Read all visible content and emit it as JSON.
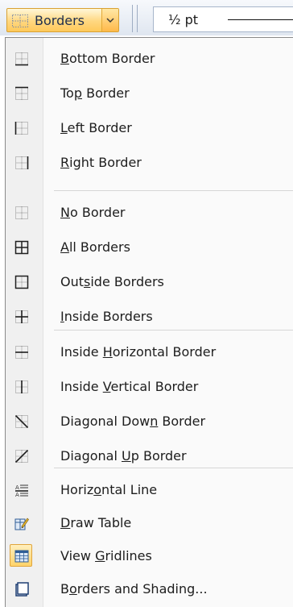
{
  "toolbar": {
    "borders_label": "Borders",
    "line_weight": "½ pt"
  },
  "colors": {
    "accent_border": "#d8a132",
    "accent_fill": "#ffd780",
    "icon_blue": "#2f5d96"
  },
  "menu": {
    "items": [
      {
        "name": "bottom-border-item",
        "icon": "bottom-border-icon",
        "label": "Bottom Border",
        "mnemonic": 0
      },
      {
        "name": "top-border-item",
        "icon": "top-border-icon",
        "label": "Top Border",
        "mnemonic": 2
      },
      {
        "name": "left-border-item",
        "icon": "left-border-icon",
        "label": "Left Border",
        "mnemonic": 0
      },
      {
        "name": "right-border-item",
        "icon": "right-border-icon",
        "label": "Right Border",
        "mnemonic": 0
      },
      {
        "name": "no-border-item",
        "icon": "no-border-icon",
        "label": "No Border",
        "mnemonic": 0
      },
      {
        "name": "all-borders-item",
        "icon": "all-borders-icon",
        "label": "All Borders",
        "mnemonic": 0
      },
      {
        "name": "outside-borders-item",
        "icon": "outside-borders-icon",
        "label": "Outside Borders",
        "mnemonic": 3
      },
      {
        "name": "inside-borders-item",
        "icon": "inside-borders-icon",
        "label": "Inside Borders",
        "mnemonic": 0
      },
      {
        "name": "inside-horizontal-border-item",
        "icon": "inside-horizontal-border-icon",
        "label": "Inside Horizontal Border",
        "mnemonic": 7
      },
      {
        "name": "inside-vertical-border-item",
        "icon": "inside-vertical-border-icon",
        "label": "Inside Vertical Border",
        "mnemonic": 7
      },
      {
        "name": "diagonal-down-border-item",
        "icon": "diagonal-down-border-icon",
        "label": "Diagonal Down Border",
        "mnemonic": 12
      },
      {
        "name": "diagonal-up-border-item",
        "icon": "diagonal-up-border-icon",
        "label": "Diagonal Up Border",
        "mnemonic": 9
      },
      {
        "name": "horizontal-line-item",
        "icon": "horizontal-line-icon",
        "label": "Horizontal Line",
        "mnemonic": 5
      },
      {
        "name": "draw-table-item",
        "icon": "draw-table-icon",
        "label": "Draw Table",
        "mnemonic": 0
      },
      {
        "name": "view-gridlines-item",
        "icon": "view-gridlines-icon",
        "label": "View Gridlines",
        "mnemonic": 5,
        "selected": true
      },
      {
        "name": "borders-and-shading-item",
        "icon": "borders-and-shading-icon",
        "label": "Borders and Shading...",
        "mnemonic": 1
      }
    ]
  }
}
